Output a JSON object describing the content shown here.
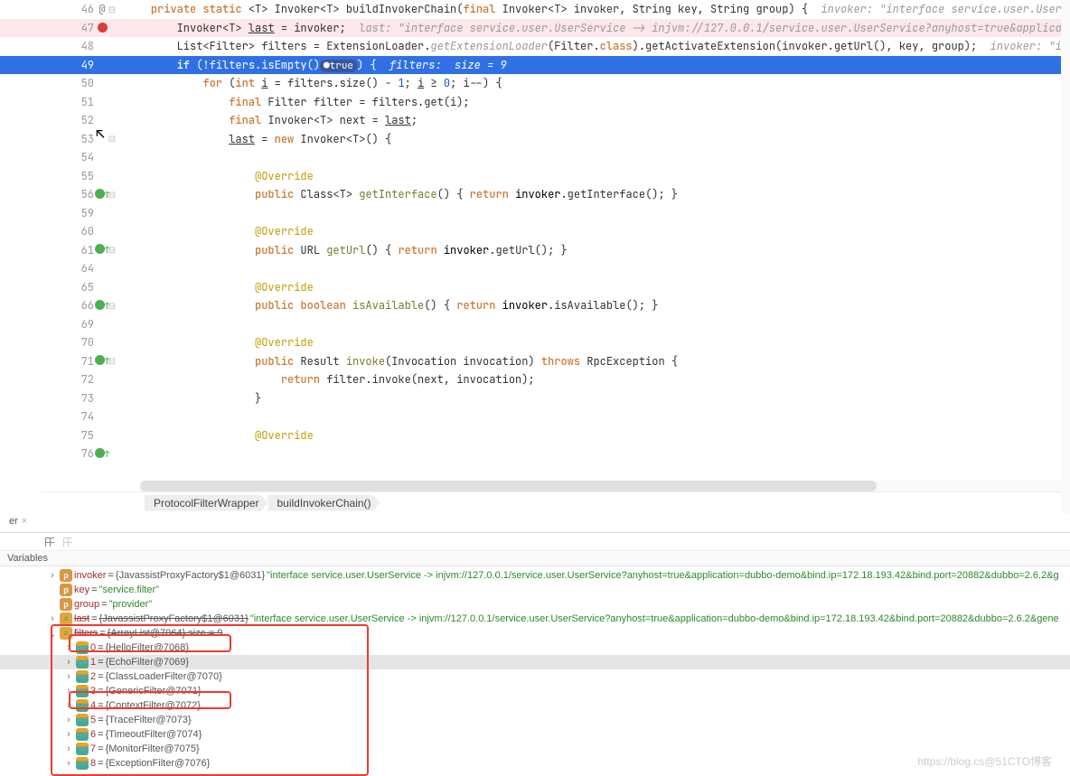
{
  "lines": [
    {
      "no": 46,
      "marker": "at",
      "fold": true,
      "cls": "",
      "html": "    <span class='kw'>private static</span> &lt;T&gt; Invoker&lt;T&gt; buildInvokerChain(<span class='kw'>final</span> Invoker&lt;T&gt; invoker, String key, String group) {  <span class='com'>invoker: \"interface service.user.UserService -> inj</span>"
    },
    {
      "no": 47,
      "marker": "bp",
      "fold": false,
      "cls": "bp-line",
      "html": "        Invoker&lt;T&gt; <span class='und'>last</span> = invoker;  <span class='com'>last: \"interface service.user.UserService -> injvm://127.0.0.1/service.user.UserService?anyhost=true&amp;application=dubbo-dem</span>"
    },
    {
      "no": 48,
      "marker": "",
      "fold": false,
      "cls": "",
      "html": "        List&lt;Filter&gt; filters = ExtensionLoader.<span class='com' style='font-style:italic'>getExtensionLoader</span>(Filter.<span class='kw'>class</span>).getActivateExtension(invoker.getUrl(), key, group);  <span class='com'>invoker: \"interface serv.</span>"
    },
    {
      "no": 49,
      "marker": "",
      "fold": false,
      "cls": "hl",
      "html": "        <span class='kw'>if</span> (!filters.isEmpty()<span class='pill-true'>●true</span>) {  <span class='com'>filters:  size = 9</span>"
    },
    {
      "no": 50,
      "marker": "",
      "fold": false,
      "cls": "",
      "html": "            <span class='kw'>for</span> (<span class='kw'>int</span> <span class='und'>i</span> = filters.size() - <span class='num'>1</span>; <span class='und'>i</span> ≥ <span class='num'>0</span>; i--) {"
    },
    {
      "no": 51,
      "marker": "",
      "fold": false,
      "cls": "",
      "html": "                <span class='kw'>final</span> Filter filter = filters.get(i);"
    },
    {
      "no": 52,
      "marker": "",
      "fold": false,
      "cls": "",
      "html": "                <span class='kw'>final</span> Invoker&lt;T&gt; next = <span class='und'>last</span>;"
    },
    {
      "no": 53,
      "marker": "",
      "fold": true,
      "cls": "",
      "html": "                <span class='und'>last</span> = <span class='kw'>new</span> Invoker&lt;T&gt;() {"
    },
    {
      "no": 54,
      "marker": "",
      "fold": false,
      "cls": "",
      "html": ""
    },
    {
      "no": 55,
      "marker": "",
      "fold": false,
      "cls": "",
      "html": "                    <span class='ann'>@Override</span>"
    },
    {
      "no": 56,
      "marker": "ov",
      "fold": true,
      "cls": "",
      "html": "                    <span class='kw'>public</span> Class&lt;T&gt; <span class='mth'>getInterface</span>() { <span class='kw'>return</span> <span class='lvl'>invoker</span>.getInterface(); }"
    },
    {
      "no": 59,
      "marker": "",
      "fold": false,
      "cls": "",
      "html": ""
    },
    {
      "no": 60,
      "marker": "",
      "fold": false,
      "cls": "",
      "html": "                    <span class='ann'>@Override</span>"
    },
    {
      "no": 61,
      "marker": "ov",
      "fold": true,
      "cls": "",
      "html": "                    <span class='kw'>public</span> URL <span class='mth'>getUrl</span>() { <span class='kw'>return</span> <span class='lvl'>invoker</span>.getUrl(); }"
    },
    {
      "no": 64,
      "marker": "",
      "fold": false,
      "cls": "",
      "html": ""
    },
    {
      "no": 65,
      "marker": "",
      "fold": false,
      "cls": "",
      "html": "                    <span class='ann'>@Override</span>"
    },
    {
      "no": 66,
      "marker": "ov",
      "fold": true,
      "cls": "",
      "html": "                    <span class='kw'>public boolean</span> <span class='mth'>isAvailable</span>() { <span class='kw'>return</span> <span class='lvl'>invoker</span>.isAvailable(); }"
    },
    {
      "no": 69,
      "marker": "",
      "fold": false,
      "cls": "",
      "html": ""
    },
    {
      "no": 70,
      "marker": "",
      "fold": false,
      "cls": "",
      "html": "                    <span class='ann'>@Override</span>"
    },
    {
      "no": 71,
      "marker": "ov",
      "fold": true,
      "cls": "",
      "html": "                    <span class='kw'>public</span> Result <span class='mth'>invoke</span>(Invocation invocation) <span class='kw'>throws</span> RpcException {"
    },
    {
      "no": 72,
      "marker": "",
      "fold": false,
      "cls": "",
      "html": "                        <span class='kw'>return</span> filter.invoke(next, invocation);"
    },
    {
      "no": 73,
      "marker": "",
      "fold": false,
      "cls": "",
      "html": "                    }"
    },
    {
      "no": 74,
      "marker": "",
      "fold": false,
      "cls": "",
      "html": ""
    },
    {
      "no": 75,
      "marker": "",
      "fold": false,
      "cls": "",
      "html": "                    <span class='ann'>@Override</span>"
    },
    {
      "no": 76,
      "marker": "ov",
      "fold": false,
      "cls": "",
      "html": ""
    }
  ],
  "crumbs": {
    "a": "ProtocolFilterWrapper",
    "b": "buildInvokerChain()"
  },
  "tab": {
    "label": "er",
    "close": "×"
  },
  "varsheader": "Variables",
  "vars": [
    {
      "ind": 0,
      "sel": false,
      "arrow": "right",
      "ico": "p",
      "name": "invoker",
      "sep": " = ",
      "val": "{JavassistProxyFactory$1@6031} ",
      "str": "\"interface service.user.UserService -> injvm://127.0.0.1/service.user.UserService?anyhost=true&application=dubbo-demo&bind.ip=172.18.193.42&bind.port=20882&dubbo=2.6.2&g"
    },
    {
      "ind": 0,
      "sel": false,
      "arrow": "blank",
      "ico": "p",
      "name": "key",
      "sep": " = ",
      "str": "\"service.filter\""
    },
    {
      "ind": 0,
      "sel": false,
      "arrow": "blank",
      "ico": "p",
      "name": "group",
      "sep": " = ",
      "str": "\"provider\""
    },
    {
      "ind": 0,
      "sel": false,
      "arrow": "right",
      "ico": "eq",
      "name": "last",
      "sep": " = ",
      "val": "{JavassistProxyFactory$1@6031} ",
      "str": "\"interface service.user.UserService -> injvm://127.0.0.1/service.user.UserService?anyhost=true&application=dubbo-demo&bind.ip=172.18.193.42&bind.port=20882&dubbo=2.6.2&gene",
      "strike": true
    },
    {
      "ind": 0,
      "sel": false,
      "arrow": "down",
      "ico": "eq",
      "name": "filters",
      "sep": " = ",
      "val": "{ArrayList@7064}  size = 9",
      "strike": true
    },
    {
      "ind": 1,
      "sel": false,
      "arrow": "right",
      "ico": "list",
      "name": "0",
      "sep": " = ",
      "val": "{HelloFilter@7068}"
    },
    {
      "ind": 1,
      "sel": true,
      "arrow": "right",
      "ico": "list",
      "name": "1",
      "sep": " = ",
      "val": "{EchoFilter@7069}"
    },
    {
      "ind": 1,
      "sel": false,
      "arrow": "right",
      "ico": "list",
      "name": "2",
      "sep": " = ",
      "val": "{ClassLoaderFilter@7070}"
    },
    {
      "ind": 1,
      "sel": false,
      "arrow": "right",
      "ico": "list",
      "name": "3",
      "sep": " = ",
      "val": "{GenericFilter@7071}"
    },
    {
      "ind": 1,
      "sel": false,
      "arrow": "right",
      "ico": "list",
      "name": "4",
      "sep": " = ",
      "val": "{ContextFilter@7072}"
    },
    {
      "ind": 1,
      "sel": false,
      "arrow": "right",
      "ico": "list",
      "name": "5",
      "sep": " = ",
      "val": "{TraceFilter@7073}"
    },
    {
      "ind": 1,
      "sel": false,
      "arrow": "right",
      "ico": "list",
      "name": "6",
      "sep": " = ",
      "val": "{TimeoutFilter@7074}"
    },
    {
      "ind": 1,
      "sel": false,
      "arrow": "right",
      "ico": "list",
      "name": "7",
      "sep": " = ",
      "val": "{MonitorFilter@7075}"
    },
    {
      "ind": 1,
      "sel": false,
      "arrow": "right",
      "ico": "list",
      "name": "8",
      "sep": " = ",
      "val": "{ExceptionFilter@7076}"
    }
  ],
  "watermark": "https://blog.cs@51CTO博客"
}
